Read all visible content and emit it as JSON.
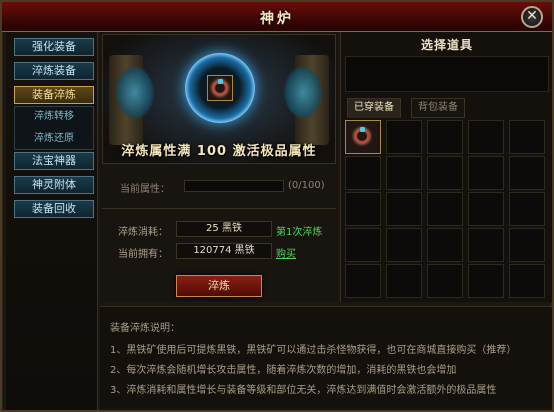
{
  "window": {
    "title": "神炉"
  },
  "sidebar": {
    "items": [
      {
        "label": "强化装备",
        "active": false
      },
      {
        "label": "淬炼装备",
        "active": false
      },
      {
        "label": "装备淬炼",
        "active": true
      },
      {
        "label": "法宝神器",
        "active": false
      },
      {
        "label": "神灵附体",
        "active": false
      },
      {
        "label": "装备回收",
        "active": false
      }
    ],
    "subitems": [
      {
        "label": "淬炼转移"
      },
      {
        "label": "淬炼还原"
      }
    ]
  },
  "banner": {
    "text": "淬炼属性满 100 激活极品属性"
  },
  "attribute": {
    "label": "当前属性：",
    "value": "(0/100)",
    "progress": 0
  },
  "cost": {
    "consume_label": "淬炼消耗：",
    "consume_value": "25 黑铁",
    "times_text": "第1次淬炼",
    "own_label": "当前拥有：",
    "own_value": "120774 黑铁",
    "buy_text": "购买"
  },
  "refine_button": {
    "label": "淬炼"
  },
  "right_panel": {
    "title": "选择道具",
    "tabs": [
      {
        "label": "已穿装备",
        "active": true
      },
      {
        "label": "背包装备",
        "active": false
      }
    ]
  },
  "description": {
    "title": "装备淬炼说明：",
    "lines": [
      "1、黑铁矿使用后可提炼黑铁，黑铁矿可以通过击杀怪物获得，也可在商城直接购买（推荐）",
      "2、每次淬炼会随机增长攻击属性，随着淬炼次数的增加，消耗的黑铁也会增加",
      "3、淬炼消耗和属性增长与装备等级和部位无关，淬炼达到满值时会激活额外的极品属性"
    ]
  }
}
